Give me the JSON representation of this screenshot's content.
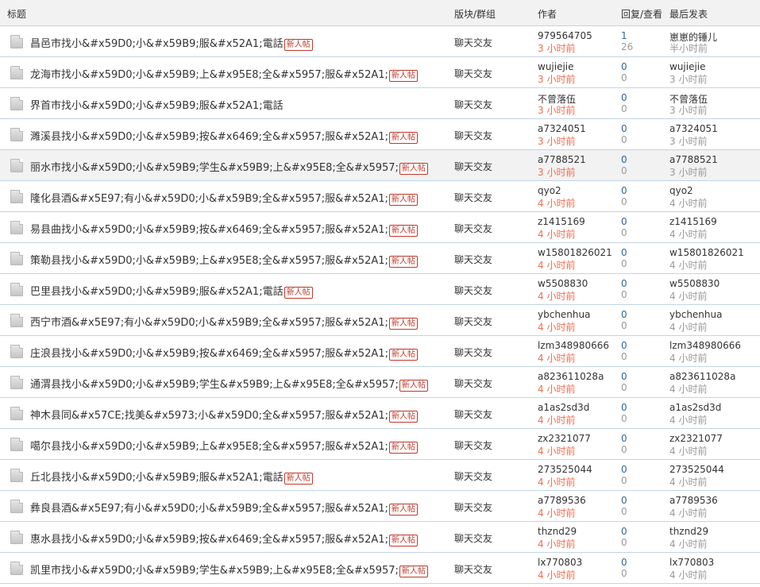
{
  "header": {
    "title": "标题",
    "forum": "版块/群组",
    "author": "作者",
    "stats": "回复/查看",
    "last_post": "最后发表"
  },
  "new_badge": "新人帖",
  "rows": [
    {
      "title": "昌邑市找小&#x59D0;小&#x59B9;服&#x52A1;電話",
      "badge": "新人帖",
      "forum": "聊天交友",
      "author": "979564705",
      "author_time": "3 小时前",
      "replies": "1",
      "views": "26",
      "last_poster": "崽崽的锤儿",
      "last_time": "半小时前"
    },
    {
      "title": "龙海市找小&#x59D0;小&#x59B9;上&#x95E8;全&#x5957;服&#x52A1;",
      "badge": "新人帖",
      "forum": "聊天交友",
      "author": "wujiejie",
      "author_time": "3 小时前",
      "replies": "0",
      "views": "0",
      "last_poster": "wujiejie",
      "last_time": "3 小时前"
    },
    {
      "title": "界首市找小&#x59D0;小&#x59B9;服&#x52A1;電話",
      "badge": "",
      "forum": "聊天交友",
      "author": "不曾落伍",
      "author_time": "3 小时前",
      "replies": "0",
      "views": "0",
      "last_poster": "不曾落伍",
      "last_time": "3 小时前"
    },
    {
      "title": "濉溪县找小&#x59D0;小&#x59B9;按&#x6469;全&#x5957;服&#x52A1;",
      "badge": "新人帖",
      "forum": "聊天交友",
      "author": "a7324051",
      "author_time": "3 小时前",
      "replies": "0",
      "views": "0",
      "last_poster": "a7324051",
      "last_time": "3 小时前"
    },
    {
      "title": "丽水市找小&#x59D0;小&#x59B9;学生&#x59B9;上&#x95E8;全&#x5957;",
      "badge": "新人帖",
      "forum": "聊天交友",
      "author": "a7788521",
      "author_time": "3 小时前",
      "replies": "0",
      "views": "0",
      "last_poster": "a7788521",
      "last_time": "3 小时前"
    },
    {
      "title": "隆化县酒&#x5E97;有小&#x59D0;小&#x59B9;全&#x5957;服&#x52A1;",
      "badge": "新人帖",
      "forum": "聊天交友",
      "author": "qyo2",
      "author_time": "4 小时前",
      "replies": "0",
      "views": "0",
      "last_poster": "qyo2",
      "last_time": "4 小时前"
    },
    {
      "title": "易县曲找小&#x59D0;小&#x59B9;按&#x6469;全&#x5957;服&#x52A1;",
      "badge": "新人帖",
      "forum": "聊天交友",
      "author": "z1415169",
      "author_time": "4 小时前",
      "replies": "0",
      "views": "0",
      "last_poster": "z1415169",
      "last_time": "4 小时前"
    },
    {
      "title": "策勒县找小&#x59D0;小&#x59B9;上&#x95E8;全&#x5957;服&#x52A1;",
      "badge": "新人帖",
      "forum": "聊天交友",
      "author": "w15801826021",
      "author_time": "4 小时前",
      "replies": "0",
      "views": "0",
      "last_poster": "w15801826021",
      "last_time": "4 小时前"
    },
    {
      "title": "巴里县找小&#x59D0;小&#x59B9;服&#x52A1;電話",
      "badge": "新人帖",
      "forum": "聊天交友",
      "author": "w5508830",
      "author_time": "4 小时前",
      "replies": "0",
      "views": "0",
      "last_poster": "w5508830",
      "last_time": "4 小时前"
    },
    {
      "title": "西宁市酒&#x5E97;有小&#x59D0;小&#x59B9;全&#x5957;服&#x52A1;",
      "badge": "新人帖",
      "forum": "聊天交友",
      "author": "ybchenhua",
      "author_time": "4 小时前",
      "replies": "0",
      "views": "0",
      "last_poster": "ybchenhua",
      "last_time": "4 小时前"
    },
    {
      "title": "庄浪县找小&#x59D0;小&#x59B9;按&#x6469;全&#x5957;服&#x52A1;",
      "badge": "新人帖",
      "forum": "聊天交友",
      "author": "lzm348980666",
      "author_time": "4 小时前",
      "replies": "0",
      "views": "0",
      "last_poster": "lzm348980666",
      "last_time": "4 小时前"
    },
    {
      "title": "通渭县找小&#x59D0;小&#x59B9;学生&#x59B9;上&#x95E8;全&#x5957;",
      "badge": "新人帖",
      "forum": "聊天交友",
      "author": "a823611028a",
      "author_time": "4 小时前",
      "replies": "0",
      "views": "0",
      "last_poster": "a823611028a",
      "last_time": "4 小时前"
    },
    {
      "title": "神木县同&#x57CE;找美&#x5973;小&#x59D0;全&#x5957;服&#x52A1;",
      "badge": "新人帖",
      "forum": "聊天交友",
      "author": "a1as2sd3d",
      "author_time": "4 小时前",
      "replies": "0",
      "views": "0",
      "last_poster": "a1as2sd3d",
      "last_time": "4 小时前"
    },
    {
      "title": "噶尔县找小&#x59D0;小&#x59B9;上&#x95E8;全&#x5957;服&#x52A1;",
      "badge": "新人帖",
      "forum": "聊天交友",
      "author": "zx2321077",
      "author_time": "4 小时前",
      "replies": "0",
      "views": "0",
      "last_poster": "zx2321077",
      "last_time": "4 小时前"
    },
    {
      "title": "丘北县找小&#x59D0;小&#x59B9;服&#x52A1;電話",
      "badge": "新人帖",
      "forum": "聊天交友",
      "author": "273525044",
      "author_time": "4 小时前",
      "replies": "0",
      "views": "0",
      "last_poster": "273525044",
      "last_time": "4 小时前"
    },
    {
      "title": "彝良县酒&#x5E97;有小&#x59D0;小&#x59B9;全&#x5957;服&#x52A1;",
      "badge": "新人帖",
      "forum": "聊天交友",
      "author": "a7789536",
      "author_time": "4 小时前",
      "replies": "0",
      "views": "0",
      "last_poster": "a7789536",
      "last_time": "4 小时前"
    },
    {
      "title": "惠水县找小&#x59D0;小&#x59B9;按&#x6469;全&#x5957;服&#x52A1;",
      "badge": "新人帖",
      "forum": "聊天交友",
      "author": "thznd29",
      "author_time": "4 小时前",
      "replies": "0",
      "views": "0",
      "last_poster": "thznd29",
      "last_time": "4 小时前"
    },
    {
      "title": "凯里市找小&#x59D0;小&#x59B9;学生&#x59B9;上&#x95E8;全&#x5957;",
      "badge": "新人帖",
      "forum": "聊天交友",
      "author": "lx770803",
      "author_time": "4 小时前",
      "replies": "0",
      "views": "0",
      "last_poster": "lx770803",
      "last_time": "4 小时前"
    }
  ]
}
